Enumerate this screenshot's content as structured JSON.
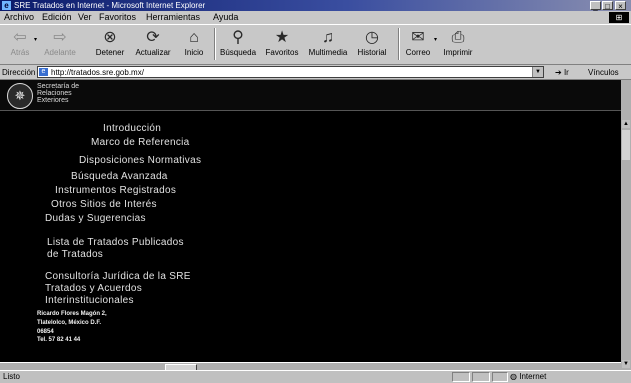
{
  "window": {
    "title": "SRE Tratados en Internet - Microsoft Internet Explorer"
  },
  "menu": {
    "items": [
      "Archivo",
      "Edición",
      "Ver",
      "Favoritos",
      "Herramientas",
      "Ayuda"
    ]
  },
  "toolbar": {
    "buttons": [
      {
        "label": "Atrás",
        "icon": "back-arrow-icon"
      },
      {
        "label": "Adelante",
        "icon": "forward-arrow-icon"
      },
      {
        "label": "Detener",
        "icon": "stop-icon"
      },
      {
        "label": "Actualizar",
        "icon": "refresh-icon"
      },
      {
        "label": "Inicio",
        "icon": "home-icon"
      },
      {
        "label": "Búsqueda",
        "icon": "search-icon"
      },
      {
        "label": "Favoritos",
        "icon": "favorites-icon"
      },
      {
        "label": "Multimedia",
        "icon": "media-icon"
      },
      {
        "label": "Historial",
        "icon": "history-icon"
      },
      {
        "label": "Correo",
        "icon": "mail-icon"
      },
      {
        "label": "Imprimir",
        "icon": "print-icon"
      }
    ]
  },
  "address": {
    "label": "Dirección",
    "value": "http://tratados.sre.gob.mx/",
    "go_label": "Ir",
    "links_label": "Vínculos"
  },
  "page": {
    "org_lines": [
      "Secretaría de",
      "Relaciones",
      "Exteriores"
    ],
    "nav": [
      "Introducción",
      "Marco de Referencia",
      "Disposiciones Normativas",
      "Búsqueda Avanzada",
      "Instrumentos Registrados",
      "Otros Sitios de Interés",
      "Dudas y Sugerencias",
      "Lista de Tratados Publicados",
      "de Tratados",
      "Consultoría Jurídica de la SRE",
      "Tratados y Acuerdos",
      "Interinstitucionales"
    ],
    "address_lines": [
      "Ricardo Flores Magón 2,",
      "Tlatelolco, México D.F.",
      "06854",
      "Tel. 57 82 41 44"
    ]
  },
  "status": {
    "left_text": "Listo",
    "zone": "Internet"
  }
}
